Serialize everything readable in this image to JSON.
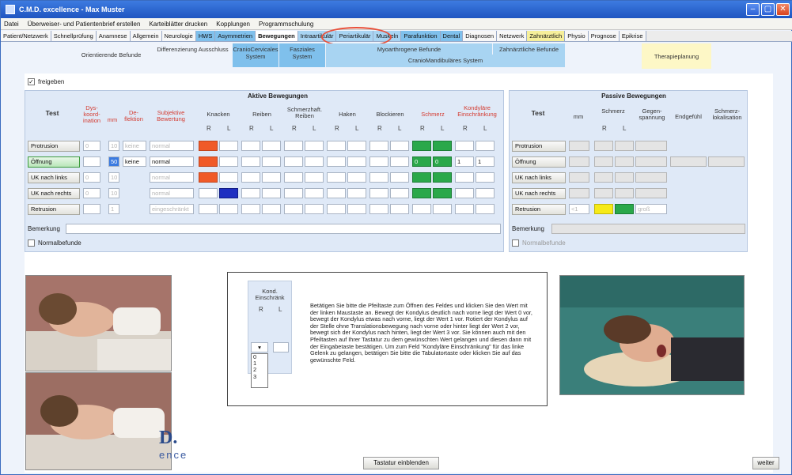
{
  "window": {
    "title": "C.M.D. excellence - Max Muster"
  },
  "menu": [
    "Datei",
    "Überweiser- und Patientenbrief erstellen",
    "Karteiblätter drucken",
    "Kopplungen",
    "Programmschulung"
  ],
  "tabs_main": [
    {
      "label": "Patient/Netzwerk",
      "style": ""
    },
    {
      "label": "Schnellprüfung",
      "style": ""
    },
    {
      "label": "Anamnese",
      "style": ""
    },
    {
      "label": "Allgemein",
      "style": ""
    },
    {
      "label": "Neurologie",
      "style": ""
    },
    {
      "label": "HWS",
      "style": "hl-blue"
    },
    {
      "label": "Asymmetrien",
      "style": "hl-blue"
    },
    {
      "label": "Bewegungen",
      "style": "active"
    },
    {
      "label": "Intraartikulär",
      "style": "hl-blue2"
    },
    {
      "label": "Periartikulär",
      "style": "hl-blue2"
    },
    {
      "label": "Muskeln",
      "style": "hl-blue2"
    },
    {
      "label": "Parafunktion",
      "style": "hl-blue"
    },
    {
      "label": "Dental",
      "style": "hl-blue"
    },
    {
      "label": "Diagnosen",
      "style": ""
    },
    {
      "label": "Netzwerk",
      "style": ""
    },
    {
      "label": "Zahnärztlich",
      "style": "hl-yellow"
    },
    {
      "label": "Physio",
      "style": ""
    },
    {
      "label": "Prognose",
      "style": ""
    },
    {
      "label": "Epikrise",
      "style": ""
    }
  ],
  "tabs_sub": {
    "orientierende": "Orientierende Befunde",
    "differenzierung": "Differenzierung Ausschluss",
    "craniocervicales": "CranioCervicales System",
    "faszialesystem": "Fasziales System",
    "myoarthrogene": "Myoarthrogene Befunde",
    "craniomandibulaeres": "CranioMandibuläres System",
    "zahnaerztliche": "Zahnärztliche Befunde",
    "therapieplanung": "Therapieplanung"
  },
  "freigeben": "freigeben",
  "active": {
    "title": "Aktive Bewegungen",
    "test": "Test",
    "col_dyskoordination": "Dys-koord-ination",
    "col_mm": "mm",
    "col_deflektion": "De-flektion",
    "col_subjektive": "Subjektive Bewertung",
    "col_knacken": "Knacken",
    "col_reiben": "Reiben",
    "col_schmerzhaft": "Schmerzhaft. Reiben",
    "col_haken": "Haken",
    "col_blockieren": "Blockieren",
    "col_schmerz": "Schmerz",
    "col_kondylaere": "Kondyläre Einschränkung",
    "r": "R",
    "l": "L",
    "rows": [
      {
        "label": "Protrusion",
        "mm": "10",
        "deflektion": "keine",
        "bewertung": "normal"
      },
      {
        "label": "Öffnung",
        "mm": "50",
        "deflektion": "keine",
        "bewertung": "normal",
        "kond_r": "1",
        "kond_l": "1"
      },
      {
        "label": "UK nach links",
        "mm": "10",
        "bewertung": "normal"
      },
      {
        "label": "UK nach rechts",
        "mm": "10",
        "bewertung": "normal"
      },
      {
        "label": "Retrusion",
        "mm": "1",
        "bewertung": "eingeschränkt"
      }
    ],
    "dys_values": [
      "0",
      "",
      "0",
      "0",
      ""
    ],
    "schmerz_value": "0",
    "bemerkung": "Bemerkung",
    "normalbefunde": "Normalbefunde"
  },
  "passive": {
    "title": "Passive Bewegungen",
    "test": "Test",
    "col_mm": "mm",
    "col_schmerz": "Schmerz",
    "col_gegenspannung": "Gegen-spannung",
    "col_endgefuehl": "Endgefühl",
    "col_schmerzlokalisation": "Schmerz-lokalisation",
    "r": "R",
    "l": "L",
    "rows": [
      "Protrusion",
      "Öffnung",
      "UK nach links",
      "UK nach rechts",
      "Retrusion"
    ],
    "retrusion_mm": "<1",
    "retrusion_gegenspannung": "groß",
    "bemerkung": "Bemerkung",
    "normalbefunde": "Normalbefunde"
  },
  "help": {
    "kond_label": "Kond. Einschränk",
    "r": "R",
    "l": "L",
    "options": [
      "0",
      "1",
      "2",
      "3"
    ],
    "text": "Betätigen Sie bitte die Pfeiltaste zum Öffnen des Feldes und klicken Sie den Wert mit der linken Maustaste an. Bewegt der Kondylus deutlich nach vorne liegt der Wert 0 vor, bewegt der Kondylus etwas nach vorne, liegt der Wert 1 vor. Rotiert der Kondylus auf der Stelle ohne Translationsbewegung nach vorne oder hinter liegt der Wert 2 vor, bewegt sich der Kondylus nach hinten, liegt der Wert 3 vor. Sie können auch mit den Pfeiltasten auf Ihrer Tastatur zu dem gewünschten Wert gelangen und diesen dann mit der Eingabetaste bestätigen. Um zum Feld \"Kondyläre Einschränkung\" für das linke Gelenk zu gelangen, betätigen Sie bitte die Tabulatortaste oder klicken Sie auf das gewünschte Feld."
  },
  "buttons": {
    "tastatur": "Tastatur einblenden",
    "weiter": "weiter"
  },
  "logo": {
    "text": "D.",
    "sub": "ence"
  },
  "colors": {
    "accent_red": "#f05a28",
    "accent_green": "#2aa84a",
    "accent_blue": "#1f2fc1",
    "accent_yellow": "#f6ea18",
    "ring": "#e9503a"
  }
}
